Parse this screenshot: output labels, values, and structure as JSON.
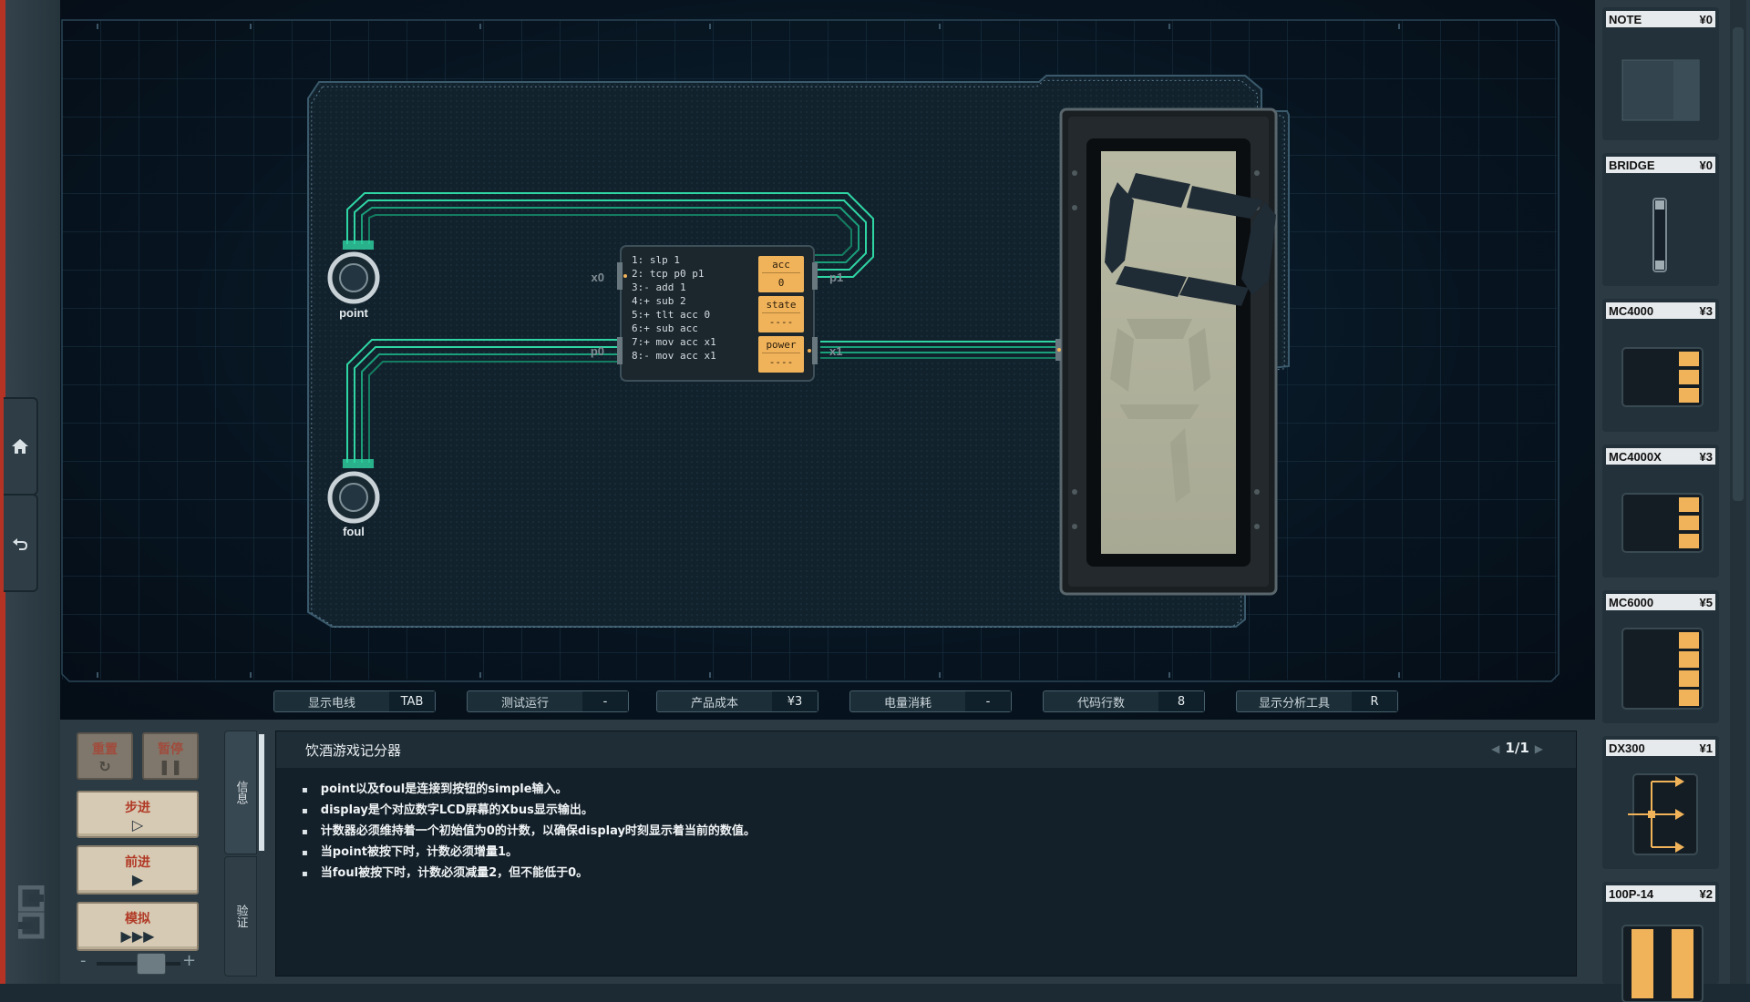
{
  "nav": {
    "home_icon": "home-icon",
    "back_icon": "undo-arrow-icon"
  },
  "board": {
    "inputs": [
      {
        "label": "point"
      },
      {
        "label": "foul"
      }
    ],
    "controller": {
      "code": [
        "1:  slp 1",
        "2:  tcp p0 p1",
        "3:- add 1",
        "4:+ sub 2",
        "5:+ tlt acc 0",
        "6:+ sub acc",
        "7:+ mov acc x1",
        "8:- mov acc x1"
      ],
      "registers": [
        {
          "name": "acc",
          "value": "0"
        },
        {
          "name": "state",
          "value": "----"
        },
        {
          "name": "power",
          "value": "----"
        }
      ],
      "pins": {
        "x0": "x0",
        "p0": "p0",
        "p1": "p1",
        "x1": "x1"
      }
    },
    "display": {
      "type": "7-segment LCD",
      "digits_lit": "C-shape segments"
    }
  },
  "status_bar": [
    {
      "key": "显示电线",
      "value": "TAB"
    },
    {
      "key": "测试运行",
      "value": "-"
    },
    {
      "key": "产品成本",
      "value": "¥3"
    },
    {
      "key": "电量消耗",
      "value": "-"
    },
    {
      "key": "代码行数",
      "value": "8"
    },
    {
      "key": "显示分析工具",
      "value": "R"
    }
  ],
  "controls": {
    "reset": "重置",
    "pause": "暂停",
    "step": "步进",
    "forward": "前进",
    "simulate": "模拟",
    "speed_minus": "-",
    "speed_plus": "+"
  },
  "tabs": {
    "info": "信息",
    "verify": "验证"
  },
  "info": {
    "title": "饮酒游戏记分器",
    "pager": "1/1",
    "items": [
      "point以及foul是连接到按钮的simple输入。",
      "display是个对应数字LCD屏幕的Xbus显示输出。",
      "计数器必须维持着一个初始值为0的计数，以确保display时刻显示着当前的数值。",
      "当point被按下时，计数必须增量1。",
      "当foul被按下时，计数必须减量2，但不能低于0。"
    ]
  },
  "palette": [
    {
      "name": "NOTE",
      "price": "¥0"
    },
    {
      "name": "BRIDGE",
      "price": "¥0"
    },
    {
      "name": "MC4000",
      "price": "¥3"
    },
    {
      "name": "MC4000X",
      "price": "¥3"
    },
    {
      "name": "MC6000",
      "price": "¥5"
    },
    {
      "name": "DX300",
      "price": "¥1"
    },
    {
      "name": "100P-14",
      "price": "¥2"
    }
  ],
  "colors": {
    "wire": "#2fd6a4",
    "accent_red": "#b53325",
    "register_orange": "#f1b35a"
  }
}
